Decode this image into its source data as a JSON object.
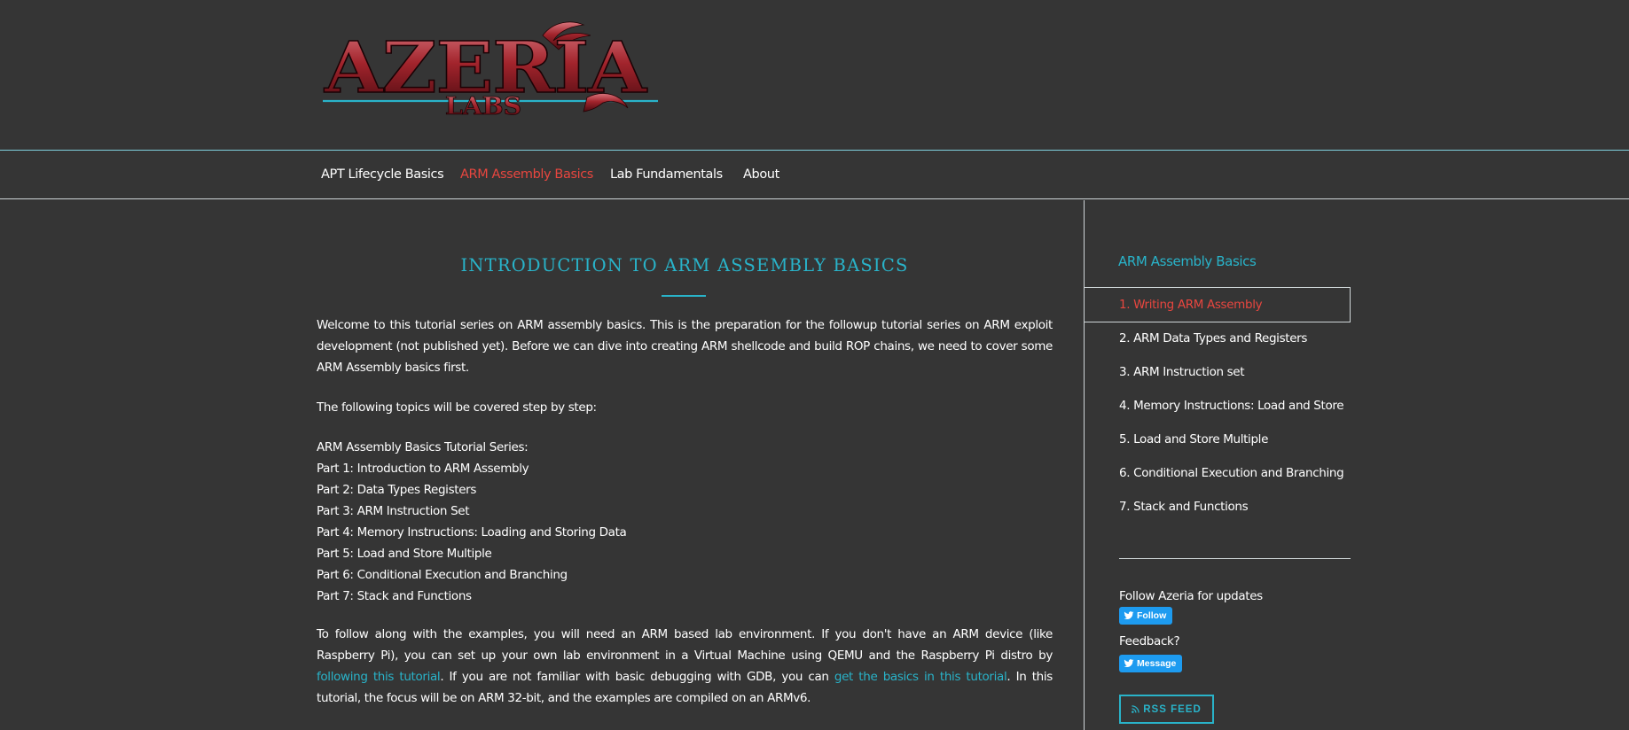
{
  "logo": {
    "text": "AZERIA",
    "subtext": "LABS"
  },
  "nav": {
    "items": [
      {
        "label": "APT Lifecycle Basics",
        "active": false
      },
      {
        "label": "ARM Assembly Basics",
        "active": true
      },
      {
        "label": "Lab Fundamentals",
        "active": false
      },
      {
        "label": "About",
        "active": false
      }
    ]
  },
  "main": {
    "title": "INTRODUCTION TO ARM ASSEMBLY BASICS",
    "intro": "Welcome to this tutorial series on ARM assembly basics. This is the preparation for the followup tutorial series on ARM exploit development (not published yet). Before we can dive into creating ARM shellcode and build ROP chains, we need to cover some ARM Assembly basics first.",
    "topics_line": "The following topics will be covered step by step:",
    "series_heading": "ARM Assembly Basics Tutorial Series:",
    "parts": [
      "Part 1: Introduction to ARM Assembly",
      "Part 2: Data Types Registers",
      "Part 3: ARM Instruction Set",
      "Part 4: Memory Instructions: Loading and Storing Data",
      "Part 5: Load and Store Multiple",
      "Part 6: Conditional Execution and Branching",
      "Part 7: Stack and Functions"
    ],
    "follow": {
      "text1": "To follow along with the examples, you will need an ARM based lab environment. If you don't have an ARM device (like Raspberry Pi), you can set up your own lab environment in a Virtual Machine using QEMU and the Raspberry Pi distro by ",
      "link1": "following this tutorial",
      "text2": ". If you are not familiar with basic debugging with GDB, you can ",
      "link2": "get the basics in this tutorial",
      "text3": ". In this tutorial, the focus will be on ARM 32-bit, and the examples are compiled on an ARMv6."
    }
  },
  "sidebar": {
    "title": "ARM Assembly Basics",
    "items": [
      {
        "label": "1. Writing ARM Assembly",
        "active": true
      },
      {
        "label": "2. ARM Data Types and Registers",
        "active": false
      },
      {
        "label": "3. ARM Instruction set",
        "active": false
      },
      {
        "label": "4. Memory Instructions: Load and Store",
        "active": false
      },
      {
        "label": "5. Load and Store Multiple",
        "active": false
      },
      {
        "label": "6. Conditional Execution and Branching",
        "active": false
      },
      {
        "label": "7. Stack and Functions",
        "active": false
      }
    ],
    "follow_text": "Follow Azeria for updates",
    "follow_button": "Follow",
    "feedback_text": "Feedback?",
    "message_button": "Message",
    "rss_button": "RSS FEED"
  },
  "colors": {
    "accent": "#29b3c9",
    "active": "#e8463f",
    "background": "#353535",
    "twitter": "#1d9bf0"
  },
  "icons": [
    "twitter-bird-icon",
    "rss-icon"
  ]
}
